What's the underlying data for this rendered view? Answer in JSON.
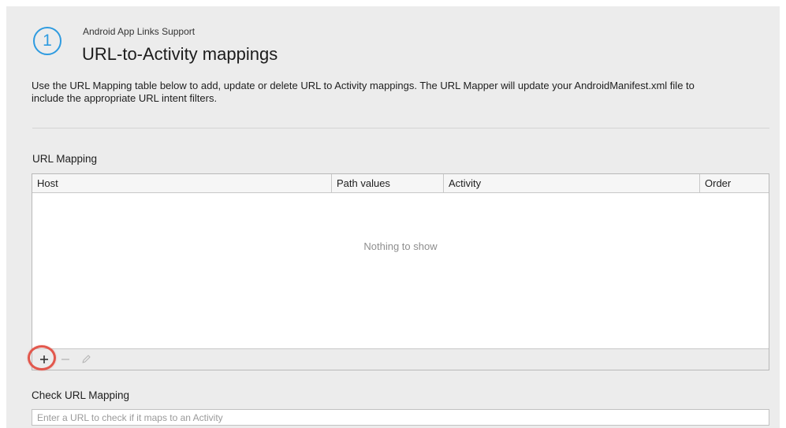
{
  "colors": {
    "accent_blue": "#2e9be0",
    "highlight_red": "#e2574c",
    "panel_bg": "#ececec"
  },
  "header": {
    "step_number": "1",
    "subtitle": "Android App Links Support",
    "title": "URL-to-Activity mappings"
  },
  "description": "Use the URL Mapping table below to add, update or delete URL to Activity mappings. The URL Mapper will update your AndroidManifest.xml file to include the appropriate URL intent filters.",
  "url_mapping": {
    "label": "URL Mapping",
    "columns": [
      "Host",
      "Path values",
      "Activity",
      "Order"
    ],
    "rows": [],
    "empty_text": "Nothing to show",
    "toolbar": {
      "add_icon": "plus-icon",
      "remove_icon": "minus-icon",
      "edit_icon": "pencil-icon"
    }
  },
  "check_url": {
    "label": "Check URL Mapping",
    "placeholder": "Enter a URL to check if it maps to an Activity",
    "value": ""
  }
}
